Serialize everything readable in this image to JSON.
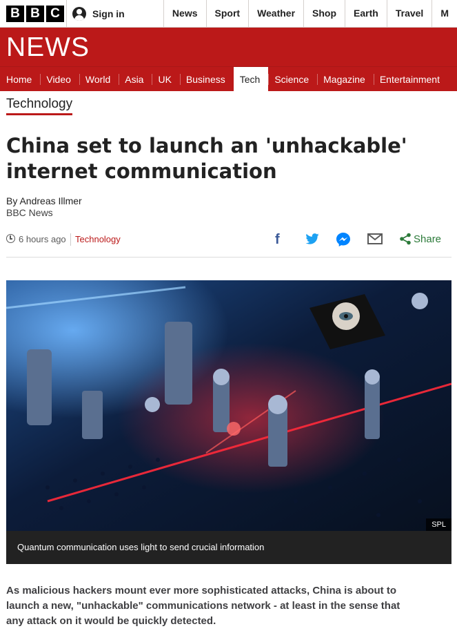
{
  "masthead": {
    "logo_letters": [
      "B",
      "B",
      "C"
    ],
    "signin_label": "Sign in",
    "nav": [
      "News",
      "Sport",
      "Weather",
      "Shop",
      "Earth",
      "Travel",
      "M"
    ]
  },
  "banner": {
    "title": "NEWS"
  },
  "section_nav": {
    "tabs": [
      "Home",
      "Video",
      "World",
      "Asia",
      "UK",
      "Business",
      "Tech",
      "Science",
      "Magazine",
      "Entertainment"
    ],
    "active": "Tech"
  },
  "section_label": "Technology",
  "article": {
    "headline": "China set to launch an 'unhackable' internet communication",
    "byline_name": "By Andreas Illmer",
    "byline_org": "BBC News",
    "timestamp": "6 hours ago",
    "section_link": "Technology",
    "share_label": "Share",
    "image_credit": "SPL",
    "image_caption": "Quantum communication uses light to send crucial information",
    "intro": "As malicious hackers mount ever more sophisticated attacks, China is about to launch a new, \"unhackable\" communications network - at least in the sense that any attack on it would be quickly detected."
  },
  "icons": [
    "user-icon",
    "clock-icon",
    "facebook-icon",
    "twitter-icon",
    "messenger-icon",
    "email-icon",
    "share-icon"
  ],
  "colors": {
    "brand_red": "#bb1919",
    "facebook": "#3b5998",
    "twitter": "#1da1f2",
    "messenger": "#0084ff",
    "share_green": "#2c7a3a"
  }
}
